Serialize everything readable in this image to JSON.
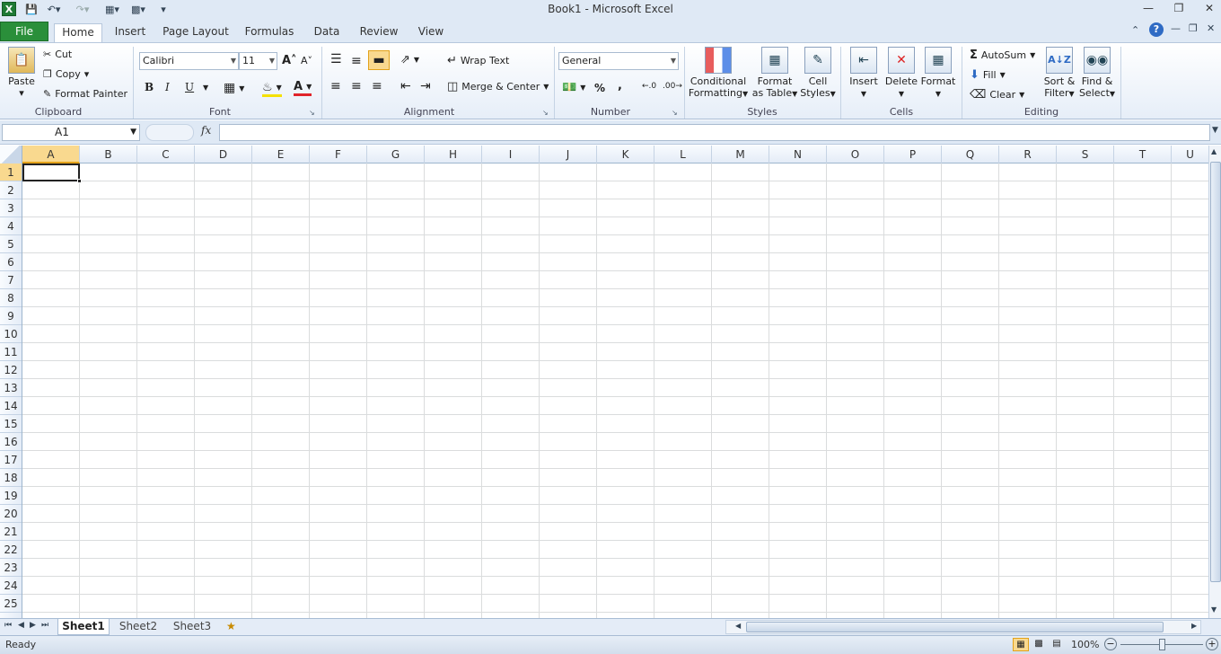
{
  "titlebar": {
    "title": "Book1  -  Microsoft Excel",
    "app_icon": "excel-icon"
  },
  "tabs": [
    "File",
    "Home",
    "Insert",
    "Page Layout",
    "Formulas",
    "Data",
    "Review",
    "View"
  ],
  "ribbon": {
    "clipboard": {
      "label": "Clipboard",
      "paste": "Paste",
      "cut": "Cut",
      "copy": "Copy",
      "format_painter": "Format Painter"
    },
    "font": {
      "label": "Font",
      "font_name": "Calibri",
      "font_size": "11",
      "bold": "B",
      "italic": "I",
      "underline": "U",
      "font_color_glyph": "A"
    },
    "alignment": {
      "label": "Alignment",
      "wrap_text": "Wrap Text",
      "merge_center": "Merge & Center"
    },
    "number": {
      "label": "Number",
      "format": "General",
      "percent": "%",
      "comma": ","
    },
    "styles": {
      "label": "Styles",
      "conditional": "Conditional Formatting",
      "format_table": "Format as Table",
      "cell_styles": "Cell Styles"
    },
    "cells": {
      "label": "Cells",
      "insert": "Insert",
      "delete": "Delete",
      "format": "Format"
    },
    "editing": {
      "label": "Editing",
      "autosum": "AutoSum",
      "fill": "Fill",
      "clear": "Clear",
      "sort": "Sort & Filter",
      "find": "Find & Select"
    }
  },
  "formula_bar": {
    "name_box": "A1",
    "fx": "fx",
    "value": ""
  },
  "columns": [
    "A",
    "B",
    "C",
    "D",
    "E",
    "F",
    "G",
    "H",
    "I",
    "J",
    "K",
    "L",
    "M",
    "N",
    "O",
    "P",
    "Q",
    "R",
    "S",
    "T",
    "U"
  ],
  "rows": [
    "1",
    "2",
    "3",
    "4",
    "5",
    "6",
    "7",
    "8",
    "9",
    "10",
    "11",
    "12",
    "13",
    "14",
    "15",
    "16",
    "17",
    "18",
    "19",
    "20",
    "21",
    "22",
    "23",
    "24",
    "25"
  ],
  "selected_cell": "A1",
  "sheets": [
    "Sheet1",
    "Sheet2",
    "Sheet3"
  ],
  "active_sheet": "Sheet1",
  "status": {
    "ready": "Ready",
    "zoom": "100%"
  }
}
